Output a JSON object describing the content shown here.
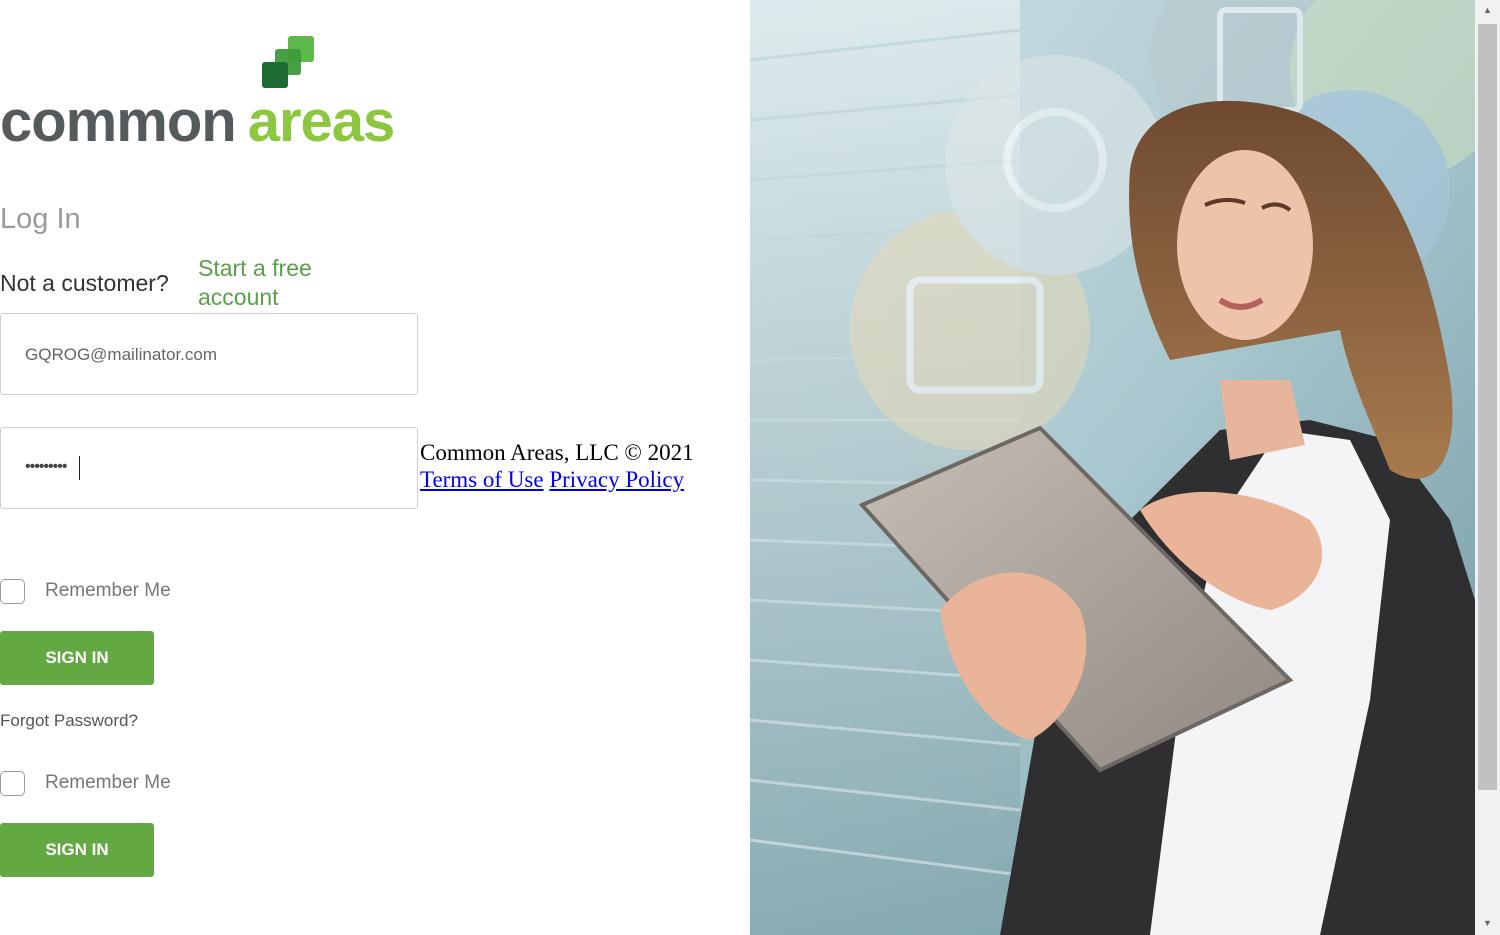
{
  "logo": {
    "text_left": "common",
    "text_right": "areas",
    "colors": {
      "dark": "#555a5c",
      "green": "#8dc63f",
      "mark_dark": "#1e6b34",
      "mark_mid": "#3f9a3e",
      "mark_light": "#5db94a"
    }
  },
  "login": {
    "title": "Log In",
    "not_customer": "Not a customer?",
    "start_link": "Start a free account",
    "email_value": "GQROG@mailinator.com",
    "password_mask": "•••••••••",
    "remember_label": "Remember Me",
    "signin_label": "SIGN IN",
    "forgot_label": "Forgot Password?"
  },
  "footer": {
    "copyright": "Common Areas, LLC © 2021",
    "terms": "Terms of Use",
    "privacy": "Privacy Policy"
  },
  "theme": {
    "accent": "#64a844",
    "link_green": "#5aa04a",
    "link_blue": "#0000ee"
  },
  "hero": {
    "icons": [
      "clipboard-check-icon",
      "user-search-icon",
      "document-wrench-icon",
      "compass-icon"
    ]
  }
}
